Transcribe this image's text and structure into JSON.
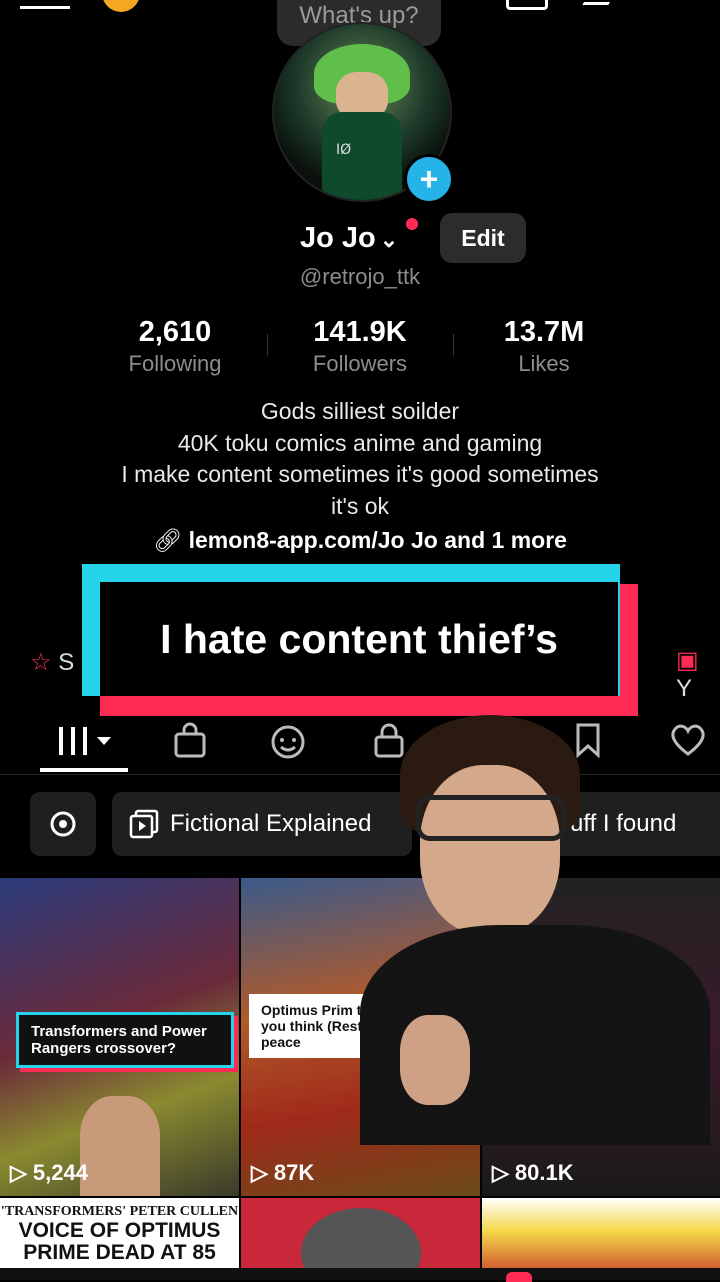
{
  "status_bubble": "What's up?",
  "avatar_number": "ΙØ",
  "profile": {
    "name": "Jo Jo",
    "edit_label": "Edit",
    "handle": "@retrojo_ttk"
  },
  "stats": [
    {
      "value": "2,610",
      "label": "Following"
    },
    {
      "value": "141.9K",
      "label": "Followers"
    },
    {
      "value": "13.7M",
      "label": "Likes"
    }
  ],
  "bio": {
    "line1": "Gods silliest soilder",
    "line2": "40K toku comics anime and gaming",
    "line3": "I make content sometimes it's good sometimes",
    "line4": "it's ok"
  },
  "link": {
    "text": "lemon8-app.com/Jo Jo",
    "more": "and 1 more"
  },
  "caption_overlay": "I hate content thief’s",
  "side_chips": {
    "left": "S",
    "right": "Y"
  },
  "filters": {
    "chip1": "Fictional Explained",
    "chip2": "uff I found"
  },
  "videos": [
    {
      "views": "5,244",
      "title": "Transformers and Power Rangers crossover?"
    },
    {
      "views": "87K",
      "title": "Optimus Prim than you think (Rest in peace"
    },
    {
      "views": "80.1K",
      "title": ""
    }
  ],
  "row2": {
    "headline_small": "'TRANSFORMERS' PETER CULLEN",
    "headline_big1": "VOICE OF OPTIMUS",
    "headline_big2": "PRIME DEAD AT 85"
  },
  "colors": {
    "accent_red": "#fe2c55",
    "accent_cyan": "#25d4ea",
    "plus_blue": "#25b3e8"
  }
}
